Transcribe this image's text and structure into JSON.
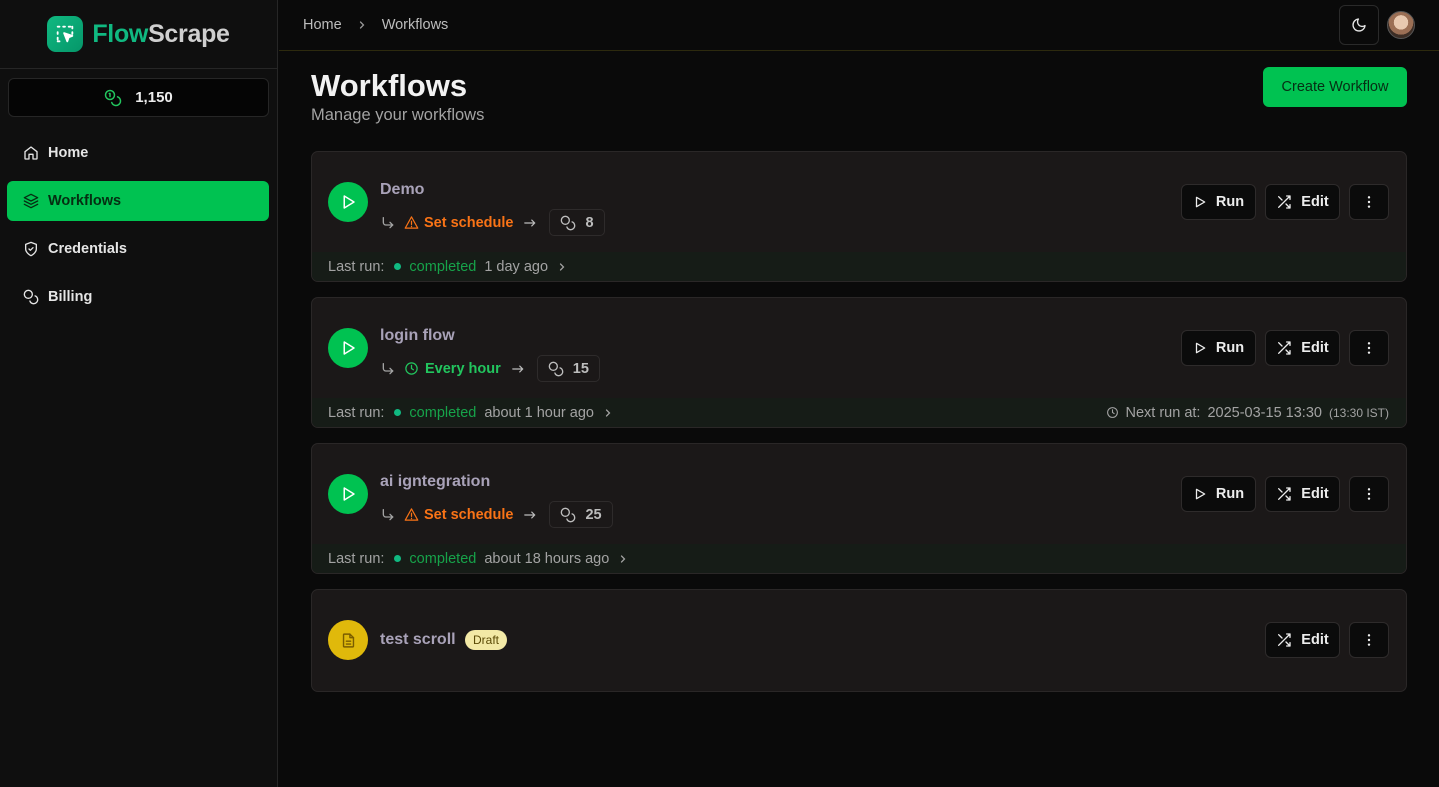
{
  "app": {
    "name_part1": "Flow",
    "name_part2": "Scrape"
  },
  "credits": {
    "value": "1,150"
  },
  "sidebar": {
    "items": [
      {
        "label": "Home",
        "icon": "home-icon",
        "active": false
      },
      {
        "label": "Workflows",
        "icon": "layers-icon",
        "active": true
      },
      {
        "label": "Credentials",
        "icon": "shield-icon",
        "active": false
      },
      {
        "label": "Billing",
        "icon": "coins-icon",
        "active": false
      }
    ]
  },
  "breadcrumb": {
    "home": "Home",
    "current": "Workflows"
  },
  "page": {
    "title": "Workflows",
    "subtitle": "Manage your workflows",
    "create_label": "Create Workflow"
  },
  "labels": {
    "run": "Run",
    "edit": "Edit",
    "last_run": "Last run:",
    "next_run": "Next run at:"
  },
  "colors": {
    "accent": "#00c251",
    "warning": "#f97316",
    "draft": "#e0b90b",
    "background": "#0a0a0a"
  },
  "workflows": [
    {
      "name": "Demo",
      "schedule": "Set schedule",
      "schedule_set": false,
      "credits": "8",
      "status": "completed",
      "last_run": "1 day ago"
    },
    {
      "name": "login flow",
      "schedule": "Every hour",
      "schedule_set": true,
      "credits": "15",
      "status": "completed",
      "last_run": "about 1 hour ago",
      "next_run": "2025-03-15 13:30",
      "next_run_tz": "(13:30 IST)"
    },
    {
      "name": "ai igntegration",
      "schedule": "Set schedule",
      "schedule_set": false,
      "credits": "25",
      "status": "completed",
      "last_run": "about 18 hours ago"
    },
    {
      "name": "test scroll",
      "badge": "Draft"
    }
  ]
}
